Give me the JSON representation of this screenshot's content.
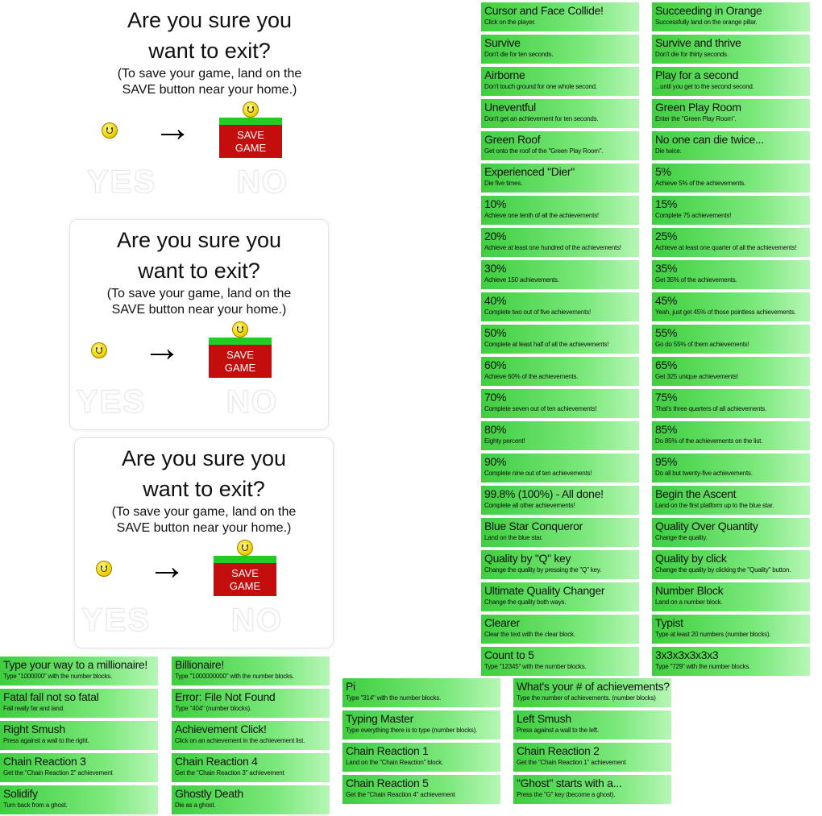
{
  "exit_dialog": {
    "title_line1": "Are you sure you",
    "title_line2": "want to exit?",
    "note_line1": "(To save your game, land on the",
    "note_line2": "SAVE button near your home.)",
    "save_line1": "SAVE",
    "save_line2": "GAME",
    "yes_label": "YES",
    "no_label": "NO",
    "arrow": "→",
    "colors": {
      "save_red": "#c40e0e",
      "save_grass": "#22cc22",
      "smiley": "#f2d400"
    }
  },
  "achievements": {
    "right_col1": [
      {
        "title": "Cursor and Face Collide!",
        "desc": "Click on the player."
      },
      {
        "title": "Survive",
        "desc": "Don't die for ten seconds."
      },
      {
        "title": "Airborne",
        "desc": "Don't touch ground for one whole second."
      },
      {
        "title": "Uneventful",
        "desc": "Don't get an achievement for ten seconds."
      },
      {
        "title": "Green Roof",
        "desc": "Get onto the roof of the \"Green Play Room\"."
      },
      {
        "title": "Experienced \"Dier\"",
        "desc": "Die five times."
      },
      {
        "title": "10%",
        "desc": "Achieve one tenth of all the achievements!"
      },
      {
        "title": "20%",
        "desc": "Achieve at least one hundred of the achievements!"
      },
      {
        "title": "30%",
        "desc": "Achieve 150 achievements."
      },
      {
        "title": "40%",
        "desc": "Complete two out of five achievements!"
      },
      {
        "title": "50%",
        "desc": "Complete at least half of all the achievements!"
      },
      {
        "title": "60%",
        "desc": "Achieve 60% of the achievements."
      },
      {
        "title": "70%",
        "desc": "Complete seven out of ten achievements!"
      },
      {
        "title": "80%",
        "desc": "Eighty percent!"
      },
      {
        "title": "90%",
        "desc": "Complete nine out of ten achievements!"
      },
      {
        "title": "99.8% (100%) - All done!",
        "desc": "Complete all other achievements!"
      },
      {
        "title": "Blue Star Conqueror",
        "desc": "Land on the blue star."
      },
      {
        "title": "Quality by \"Q\" key",
        "desc": "Change the quality by pressing the \"Q\" key."
      },
      {
        "title": "Ultimate Quality Changer",
        "desc": "Change the quality both ways."
      },
      {
        "title": "Clearer",
        "desc": "Clear the text with the clear block."
      },
      {
        "title": "Count to 5",
        "desc": "Type \"12345\" with the number blocks."
      }
    ],
    "right_col2": [
      {
        "title": "Succeeding in Orange",
        "desc": "Successfully land on the orange pillar."
      },
      {
        "title": "Survive and thrive",
        "desc": "Don't die for thirty seconds."
      },
      {
        "title": "Play for a second",
        "desc": "...until you get to the second second."
      },
      {
        "title": "Green Play Room",
        "desc": "Enter the \"Green Play Room\"."
      },
      {
        "title": "No one can die twice...",
        "desc": "Die twice."
      },
      {
        "title": "5%",
        "desc": "Achieve 5% of the achievements."
      },
      {
        "title": "15%",
        "desc": "Complete 75 achievements!"
      },
      {
        "title": "25%",
        "desc": "Achieve at least one quarter of all the achievements!"
      },
      {
        "title": "35%",
        "desc": "Get 35% of the achievements."
      },
      {
        "title": "45%",
        "desc": "Yeah, just get 45% of those pointless achievements."
      },
      {
        "title": "55%",
        "desc": "Go do 55% of them achievements!"
      },
      {
        "title": "65%",
        "desc": "Get 325 unique achievements!"
      },
      {
        "title": "75%",
        "desc": "That's three quarters of all achievements."
      },
      {
        "title": "85%",
        "desc": "Do 85% of the achievements on the list."
      },
      {
        "title": "95%",
        "desc": "Do all but twenty-five achievements."
      },
      {
        "title": "Begin the Ascent",
        "desc": "Land on the first platform up to the blue star."
      },
      {
        "title": "Quality Over Quantity",
        "desc": "Change the quality."
      },
      {
        "title": "Quality by click",
        "desc": "Change the quality by clicking the \"Quality\" button."
      },
      {
        "title": "Number Block",
        "desc": "Land on a number block."
      },
      {
        "title": "Typist",
        "desc": "Type at least 20 numbers (number blocks)."
      },
      {
        "title": "3x3x3x3x3x3",
        "desc": "Type \"729\" with the number blocks."
      }
    ],
    "bottom_col1": [
      {
        "title": "Type your way to a millionaire!",
        "desc": "Type \"1000000\" with the number blocks."
      },
      {
        "title": "Fatal fall not so fatal",
        "desc": "Fall really far and land."
      },
      {
        "title": "Right Smush",
        "desc": "Press against a wall to the right."
      },
      {
        "title": "Chain Reaction 3",
        "desc": "Get the \"Chain Reaction 2\" achievement"
      },
      {
        "title": "Solidify",
        "desc": "Turn back from a ghost."
      }
    ],
    "bottom_col2": [
      {
        "title": "Billionaire!",
        "desc": "Type \"1000000000\" with the number blocks."
      },
      {
        "title": "Error: File Not Found",
        "desc": "Type \"404\" (number blocks)."
      },
      {
        "title": "Achievement Click!",
        "desc": "Click on an achievement in the achievement list."
      },
      {
        "title": "Chain Reaction 4",
        "desc": "Get the \"Chain Reaction 3\" achievement"
      },
      {
        "title": "Ghostly Death",
        "desc": "Die as a ghost."
      }
    ],
    "bottom_col3": [
      {
        "title": "Pi",
        "desc": "Type \"314\" with the number blocks."
      },
      {
        "title": "Typing Master",
        "desc": "Type everything there is to type (number blocks)."
      },
      {
        "title": "Chain Reaction 1",
        "desc": "Land on the \"Chain Reaction\" block."
      },
      {
        "title": "Chain Reaction 5",
        "desc": "Get the \"Chain Reaction 4\" achievement"
      }
    ],
    "bottom_col4": [
      {
        "title": "What's your # of achievements?",
        "desc": "Type the number of achievements. (number blocks)"
      },
      {
        "title": "Left Smush",
        "desc": "Press against a wall to the left."
      },
      {
        "title": "Chain Reaction 2",
        "desc": "Get the \"Chain Reaction 1\" achievement"
      },
      {
        "title": "\"Ghost\" starts with a...",
        "desc": "Press the \"G\" key (become a ghost)."
      }
    ]
  }
}
